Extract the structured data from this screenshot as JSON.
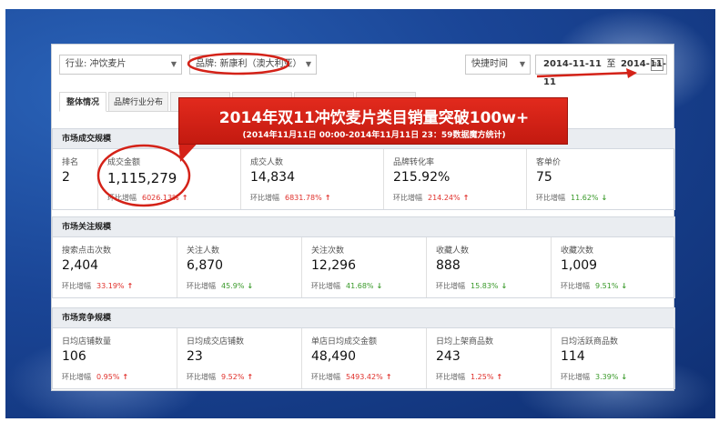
{
  "filters": {
    "industry": "行业: 冲饮麦片",
    "brand": "品牌: 新康利（澳大利亚）",
    "quick_time": "快捷时间",
    "date_from": "2014-11-11",
    "date_to_sep": "至",
    "date_to": "2014-11-11",
    "calendar_label": "30"
  },
  "tabs": [
    {
      "label": "整体情况",
      "active": true
    },
    {
      "label": "品牌行业分布",
      "active": false
    },
    {
      "label": "",
      "active": false
    },
    {
      "label": "",
      "active": false
    },
    {
      "label": "",
      "active": false
    },
    {
      "label": "",
      "active": false
    }
  ],
  "banner": {
    "title": "2014年双11冲饮麦片类目销量突破100w+",
    "subtitle": "(2014年11月11日 00:00-2014年11月11日 23：59数据魔方统计)"
  },
  "sections": [
    {
      "title": "市场成交规模",
      "cells": [
        {
          "label": "排名",
          "value": "2",
          "change_label": "",
          "change": "",
          "dir": ""
        },
        {
          "label": "成交金额",
          "value": "1,115,279",
          "change_label": "环比增幅",
          "change": "6026.13%",
          "dir": "up"
        },
        {
          "label": "成交人数",
          "value": "14,834",
          "change_label": "环比增幅",
          "change": "6831.78%",
          "dir": "up"
        },
        {
          "label": "品牌转化率",
          "value": "215.92%",
          "change_label": "环比增幅",
          "change": "214.24%",
          "dir": "up"
        },
        {
          "label": "客单价",
          "value": "75",
          "change_label": "环比增幅",
          "change": "11.62%",
          "dir": "down"
        }
      ]
    },
    {
      "title": "市场关注规模",
      "cells": [
        {
          "label": "搜索点击次数",
          "value": "2,404",
          "change_label": "环比增幅",
          "change": "33.19%",
          "dir": "up"
        },
        {
          "label": "关注人数",
          "value": "6,870",
          "change_label": "环比增幅",
          "change": "45.9%",
          "dir": "down"
        },
        {
          "label": "关注次数",
          "value": "12,296",
          "change_label": "环比增幅",
          "change": "41.68%",
          "dir": "down"
        },
        {
          "label": "收藏人数",
          "value": "888",
          "change_label": "环比增幅",
          "change": "15.83%",
          "dir": "down"
        },
        {
          "label": "收藏次数",
          "value": "1,009",
          "change_label": "环比增幅",
          "change": "9.51%",
          "dir": "down"
        }
      ]
    },
    {
      "title": "市场竞争规模",
      "cells": [
        {
          "label": "日均店铺数量",
          "value": "106",
          "change_label": "环比增幅",
          "change": "0.95%",
          "dir": "up"
        },
        {
          "label": "日均成交店铺数",
          "value": "23",
          "change_label": "环比增幅",
          "change": "9.52%",
          "dir": "up"
        },
        {
          "label": "单店日均成交金额",
          "value": "48,490",
          "change_label": "环比增幅",
          "change": "5493.42%",
          "dir": "up"
        },
        {
          "label": "日均上架商品数",
          "value": "243",
          "change_label": "环比增幅",
          "change": "1.25%",
          "dir": "up"
        },
        {
          "label": "日均活跃商品数",
          "value": "114",
          "change_label": "环比增幅",
          "change": "3.39%",
          "dir": "down"
        }
      ]
    }
  ],
  "colors": {
    "up": "#e0302b",
    "down": "#3a9a2a",
    "accent_red": "#d42218",
    "header_bg": "#eaedf1"
  }
}
